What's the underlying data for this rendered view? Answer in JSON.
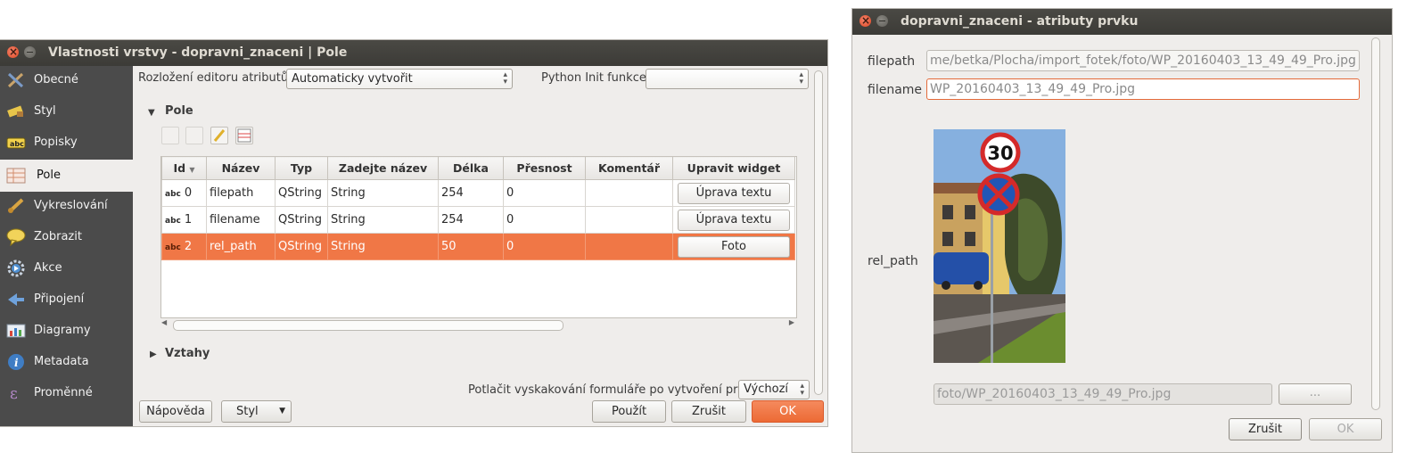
{
  "layer_props": {
    "title": "Vlastnosti vrstvy - dopravni_znaceni | Pole",
    "sidebar": [
      {
        "label": "Obecné",
        "icon": "tools-icon"
      },
      {
        "label": "Styl",
        "icon": "brush-icon"
      },
      {
        "label": "Popisky",
        "icon": "labels-abc-icon"
      },
      {
        "label": "Pole",
        "icon": "table-icon"
      },
      {
        "label": "Vykreslování",
        "icon": "paintbrush-icon"
      },
      {
        "label": "Zobrazit",
        "icon": "speech-bubble-icon"
      },
      {
        "label": "Akce",
        "icon": "gear-play-icon"
      },
      {
        "label": "Připojení",
        "icon": "join-arrow-icon"
      },
      {
        "label": "Diagramy",
        "icon": "chart-icon"
      },
      {
        "label": "Metadata",
        "icon": "info-icon"
      },
      {
        "label": "Proměnné",
        "icon": "epsilon-icon"
      }
    ],
    "active_item": "Pole",
    "editor_layout_label": "Rozložení editoru atributů:",
    "editor_layout_value": "Automaticky vytvořit",
    "python_init_label": "Python Init funkce",
    "python_init_value": "",
    "section_fields": "Pole",
    "section_relations": "Vztahy",
    "table": {
      "headers": [
        "Id",
        "Název",
        "Typ",
        "Zadejte název",
        "Délka",
        "Přesnost",
        "Komentář",
        "Upravit widget"
      ],
      "rows": [
        {
          "type_icon": "abc",
          "id": "0",
          "name": "filepath",
          "type": "QString",
          "type_name": "String",
          "length": "254",
          "precision": "0",
          "comment": "",
          "widget": "Úprava textu"
        },
        {
          "type_icon": "abc",
          "id": "1",
          "name": "filename",
          "type": "QString",
          "type_name": "String",
          "length": "254",
          "precision": "0",
          "comment": "",
          "widget": "Úprava textu"
        },
        {
          "type_icon": "abc",
          "id": "2",
          "name": "rel_path",
          "type": "QString",
          "type_name": "String",
          "length": "50",
          "precision": "0",
          "comment": "",
          "widget": "Foto"
        }
      ],
      "selected_row": 2
    },
    "suppress_label": "Potlačit vyskakování formuláře po vytvoření prvku",
    "suppress_value": "Výchozí",
    "buttons": {
      "help": "Nápověda",
      "style": "Styl",
      "apply": "Použít",
      "cancel": "Zrušit",
      "ok": "OK"
    },
    "colors": {
      "accent": "#f07746",
      "sidebar_bg": "#4b4b4b"
    }
  },
  "feature_attrs": {
    "title": "dopravni_znaceni - atributy prvku",
    "filepath_label": "filepath",
    "filepath_value": "me/betka/Plocha/import_fotek/foto/WP_20160403_13_49_49_Pro.jpg",
    "filename_label": "filename",
    "filename_value": "WP_20160403_13_49_49_Pro.jpg",
    "relpath_label": "rel_path",
    "photo_path": "foto/WP_20160403_13_49_49_Pro.jpg",
    "browse_label": "...",
    "sign_speed": "30",
    "buttons": {
      "cancel": "Zrušit",
      "ok": "OK"
    }
  }
}
